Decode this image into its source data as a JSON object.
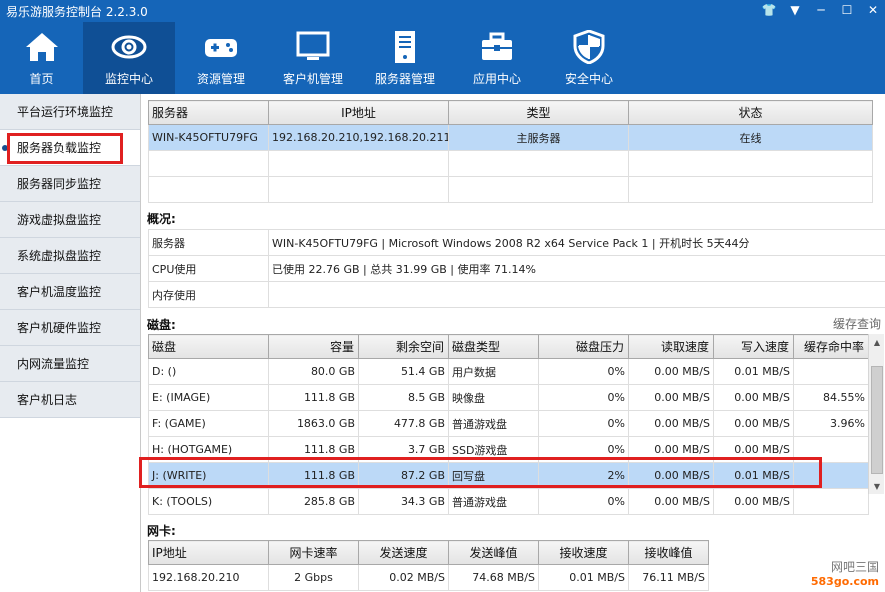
{
  "app": {
    "title": "易乐游服务控制台 2.2.3.0"
  },
  "nav": [
    {
      "label": "首页",
      "icon": "home-icon"
    },
    {
      "label": "监控中心",
      "icon": "eye-icon"
    },
    {
      "label": "资源管理",
      "icon": "gamepad-icon"
    },
    {
      "label": "客户机管理",
      "icon": "monitor-icon"
    },
    {
      "label": "服务器管理",
      "icon": "server-icon"
    },
    {
      "label": "应用中心",
      "icon": "toolbox-icon"
    },
    {
      "label": "安全中心",
      "icon": "shield-icon"
    }
  ],
  "sidebar": [
    {
      "label": "平台运行环境监控"
    },
    {
      "label": "服务器负载监控"
    },
    {
      "label": "服务器同步监控"
    },
    {
      "label": "游戏虚拟盘监控"
    },
    {
      "label": "系统虚拟盘监控"
    },
    {
      "label": "客户机温度监控"
    },
    {
      "label": "客户机硬件监控"
    },
    {
      "label": "内网流量监控"
    },
    {
      "label": "客户机日志"
    }
  ],
  "servers": {
    "headers": [
      "服务器",
      "IP地址",
      "类型",
      "状态"
    ],
    "rows": [
      [
        "WIN-K45OFTU79FG",
        "192.168.20.210,192.168.20.211",
        "主服务器",
        "在线"
      ]
    ]
  },
  "overview": {
    "title": "概况:",
    "rows": [
      {
        "label": "服务器",
        "value": "WIN-K45OFTU79FG | Microsoft Windows 2008 R2 x64 Service Pack 1 | 开机时长 5天44分"
      },
      {
        "label": "CPU使用",
        "value": "已使用 22.76  GB | 总共 31.99  GB | 使用率 71.14%"
      },
      {
        "label": "内存使用",
        "value": ""
      }
    ]
  },
  "disks": {
    "title": "磁盘:",
    "cache_link": "缓存查询",
    "headers": [
      "磁盘",
      "容量",
      "剩余空间",
      "磁盘类型",
      "磁盘压力",
      "读取速度",
      "写入速度",
      "缓存命中率"
    ],
    "rows": [
      [
        "D: ()",
        "80.0  GB",
        "51.4  GB",
        "用户数据",
        "0%",
        "0.00  MB/S",
        "0.01  MB/S",
        ""
      ],
      [
        "E: (IMAGE)",
        "111.8  GB",
        "8.5  GB",
        "映像盘",
        "0%",
        "0.00  MB/S",
        "0.00  MB/S",
        "84.55%"
      ],
      [
        "F: (GAME)",
        "1863.0  GB",
        "477.8  GB",
        "普通游戏盘",
        "0%",
        "0.00  MB/S",
        "0.00  MB/S",
        "3.96%"
      ],
      [
        "H: (HOTGAME)",
        "111.8  GB",
        "3.7  GB",
        "SSD游戏盘",
        "0%",
        "0.00  MB/S",
        "0.00  MB/S",
        ""
      ],
      [
        "J: (WRITE)",
        "111.8  GB",
        "87.2  GB",
        "回写盘",
        "2%",
        "0.00  MB/S",
        "0.01  MB/S",
        ""
      ],
      [
        "K: (TOOLS)",
        "285.8  GB",
        "34.3  GB",
        "普通游戏盘",
        "0%",
        "0.00  MB/S",
        "0.00  MB/S",
        ""
      ]
    ],
    "selected_row": 4
  },
  "nics": {
    "title": "网卡:",
    "headers": [
      "IP地址",
      "网卡速率",
      "发送速度",
      "发送峰值",
      "接收速度",
      "接收峰值"
    ],
    "rows": [
      [
        "192.168.20.210",
        "2 Gbps",
        "0.02  MB/S",
        "74.68  MB/S",
        "0.01  MB/S",
        "76.11  MB/S"
      ]
    ]
  },
  "watermark": {
    "line1": "网吧三国",
    "line2": "583go.com"
  },
  "colors": {
    "brand": "#1565b8",
    "active_nav": "#0f4f95",
    "highlight": "#e02020",
    "selection": "#bcd9f7"
  }
}
